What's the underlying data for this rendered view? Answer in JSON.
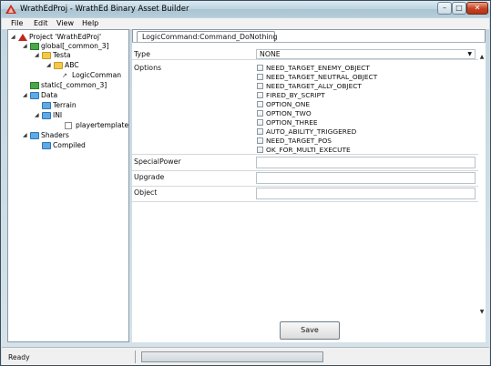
{
  "window": {
    "title": "WrathEdProj - WrathEd Binary Asset Builder",
    "controls": {
      "minimize": "–",
      "maximize": "□",
      "close": "✕"
    }
  },
  "menu": [
    "File",
    "Edit",
    "View",
    "Help"
  ],
  "tree": {
    "project": "Project 'WrathEdProj'",
    "global": "global[_common_3]",
    "testa": "Testa",
    "abc": "ABC",
    "logic_command": "LogicComman",
    "static": "static[_common_3]",
    "data": "Data",
    "terrain": "Terrain",
    "ini": "INI",
    "playertemplate": "playertemplate.in",
    "shaders": "Shaders",
    "compiled": "Compiled"
  },
  "tab": {
    "label": "LogicCommand:Command_DoNothing"
  },
  "form": {
    "type_label": "Type",
    "type_value": "NONE",
    "options_label": "Options",
    "options": [
      "NEED_TARGET_ENEMY_OBJECT",
      "NEED_TARGET_NEUTRAL_OBJECT",
      "NEED_TARGET_ALLY_OBJECT",
      "FIRED_BY_SCRIPT",
      "OPTION_ONE",
      "OPTION_TWO",
      "OPTION_THREE",
      "AUTO_ABILITY_TRIGGERED",
      "NEED_TARGET_POS",
      "OK_FOR_MULTI_EXECUTE"
    ],
    "special_power_label": "SpecialPower",
    "upgrade_label": "Upgrade",
    "object_label": "Object",
    "save_label": "Save"
  },
  "status": {
    "text": "Ready"
  },
  "scroll": {
    "up": "▲",
    "down": "▼"
  },
  "tree_glyphs": {
    "expanded": "◢",
    "command": "↗"
  }
}
